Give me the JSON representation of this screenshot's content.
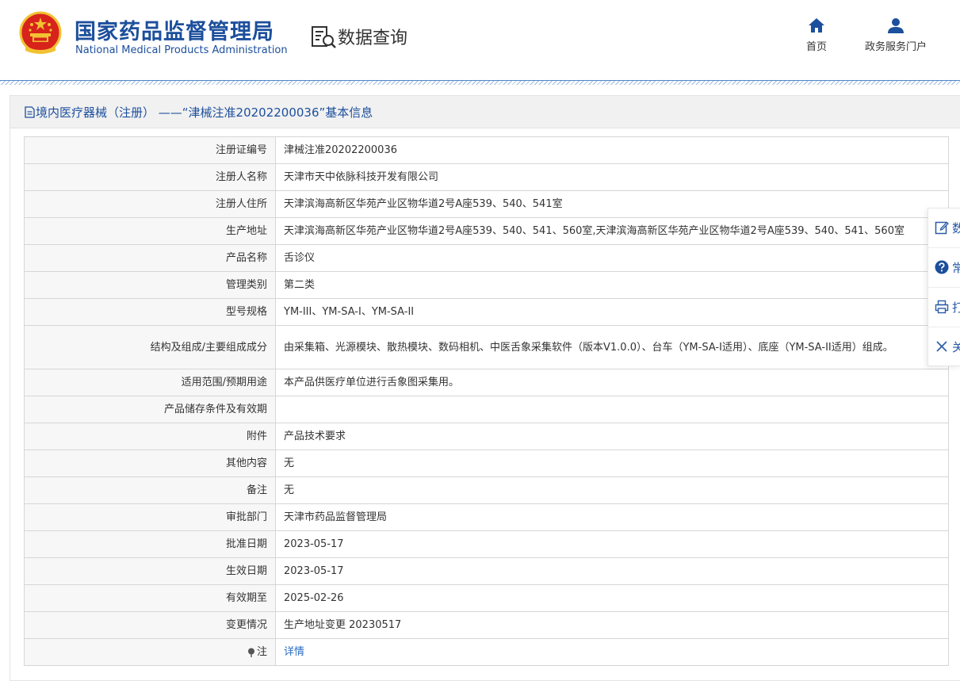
{
  "header": {
    "logo_cn": "国家药品监督管理局",
    "logo_en": "National Medical Products Administration",
    "section_title": "数据查询",
    "nav": [
      {
        "label": "首页",
        "icon": "home-icon"
      },
      {
        "label": "政务服务门户",
        "icon": "user-icon"
      }
    ]
  },
  "panel": {
    "title": "境内医疗器械（注册） ——“津械注准20202200036”基本信息",
    "rows": [
      {
        "key": "注册证编号",
        "value": "津械注准20202200036"
      },
      {
        "key": "注册人名称",
        "value": "天津市天中依脉科技开发有限公司"
      },
      {
        "key": "注册人住所",
        "value": "天津滨海高新区华苑产业区物华道2号A座539、540、541室"
      },
      {
        "key": "生产地址",
        "value": "天津滨海高新区华苑产业区物华道2号A座539、540、541、560室,天津滨海高新区华苑产业区物华道2号A座539、540、541、560室"
      },
      {
        "key": "产品名称",
        "value": "舌诊仪"
      },
      {
        "key": "管理类别",
        "value": "第二类"
      },
      {
        "key": "型号规格",
        "value": "YM-III、YM-SA-I、YM-SA-II"
      },
      {
        "key": "结构及组成/主要组成成分",
        "value": "由采集箱、光源模块、散热模块、数码相机、中医舌象采集软件（版本V1.0.0）、台车（YM-SA-I适用）、底座（YM-SA-II适用）组成。"
      },
      {
        "key": "适用范围/预期用途",
        "value": "本产品供医疗单位进行舌象图采集用。"
      },
      {
        "key": "产品储存条件及有效期",
        "value": ""
      },
      {
        "key": "附件",
        "value": "产品技术要求"
      },
      {
        "key": "其他内容",
        "value": "无"
      },
      {
        "key": "备注",
        "value": "无"
      },
      {
        "key": "审批部门",
        "value": "天津市药品监督管理局"
      },
      {
        "key": "批准日期",
        "value": "2023-05-17"
      },
      {
        "key": "生效日期",
        "value": "2023-05-17"
      },
      {
        "key": "有效期至",
        "value": "2025-02-26"
      },
      {
        "key": "变更情况",
        "value": "生产地址变更 20230517"
      }
    ],
    "note_row": {
      "key": "注",
      "link": "详情",
      "icon": "pin-icon"
    }
  },
  "float_toolbar": [
    {
      "label": "数",
      "icon": "edit-icon"
    },
    {
      "label": "常",
      "icon": "question-icon"
    },
    {
      "label": "打",
      "icon": "print-icon"
    },
    {
      "label": "关",
      "icon": "close-icon"
    }
  ],
  "colors": {
    "brand_blue": "#1c4f9c",
    "link_blue": "#2a6bc2",
    "emblem_red": "#d7231c",
    "emblem_gold": "#f1c232"
  }
}
